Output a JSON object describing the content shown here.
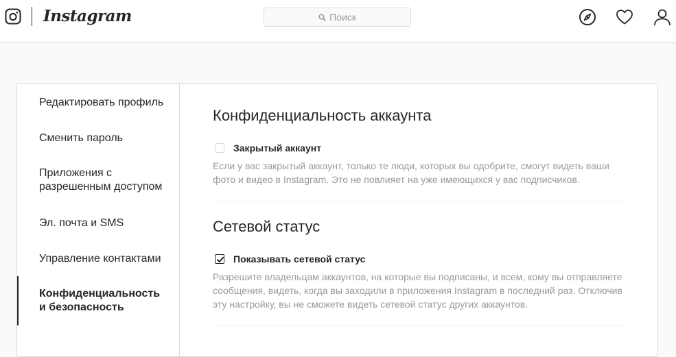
{
  "header": {
    "wordmark": "Instagram",
    "search_placeholder": "Поиск",
    "icons": [
      "instagram-logo-icon",
      "search-icon",
      "compass-icon",
      "heart-icon",
      "profile-icon"
    ]
  },
  "sidebar": {
    "items": [
      {
        "label": "Редактировать профиль",
        "active": false
      },
      {
        "label": "Сменить пароль",
        "active": false
      },
      {
        "label": "Приложения с разрешенным доступом",
        "active": false
      },
      {
        "label": "Эл. почта и SMS",
        "active": false
      },
      {
        "label": "Управление контактами",
        "active": false
      },
      {
        "label": "Конфиденциальность и безопасность",
        "active": true
      }
    ]
  },
  "main": {
    "sections": [
      {
        "title": "Конфиденциальность аккаунта",
        "checkbox_label": "Закрытый аккаунт",
        "checked": false,
        "description": "Если у вас закрытый аккаунт, только те люди, которых вы одобрите, смогут видеть ваши фото и видео в Instagram. Это не повлияет на уже имеющихся у вас подписчиков."
      },
      {
        "title": "Сетевой статус",
        "checkbox_label": "Показывать сетевой статус",
        "checked": true,
        "description": "Разрешите владельцам аккаунтов, на которые вы подписаны, и всем, кому вы отправляете сообщения, видеть, когда вы заходили в приложения Instagram в последний раз. Отключив эту настройку, вы не сможете видеть сетевой статус других аккаунтов."
      }
    ]
  },
  "colors": {
    "text": "#262626",
    "secondary_text": "#999999",
    "border": "#dbdbdb",
    "background": "#fafafa"
  }
}
